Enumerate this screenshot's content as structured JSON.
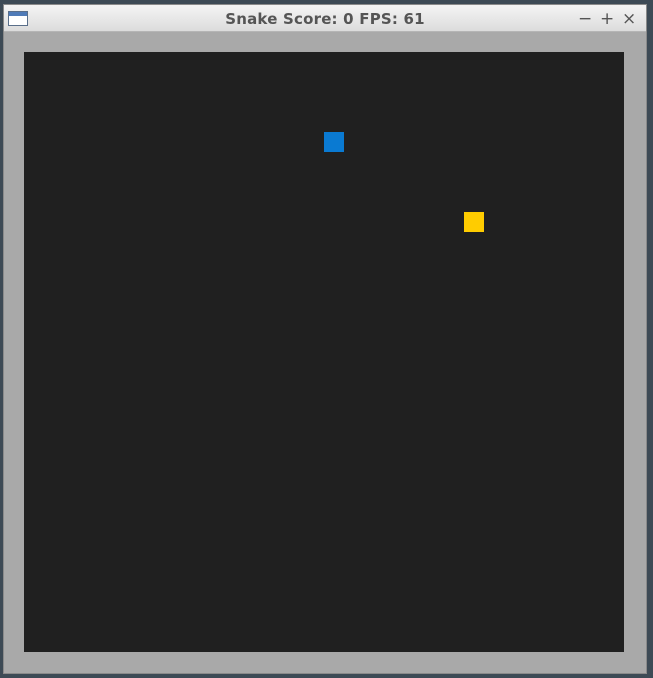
{
  "window": {
    "title": "Snake Score: 0 FPS: 61",
    "controls": {
      "minimize": "−",
      "maximize": "+",
      "close": "×"
    }
  },
  "game": {
    "score": 0,
    "fps": 61,
    "snake_color": "#0a7ad2",
    "food_color": "#ffcc00",
    "board_color": "#202020",
    "border_color": "#a9a9a9"
  }
}
